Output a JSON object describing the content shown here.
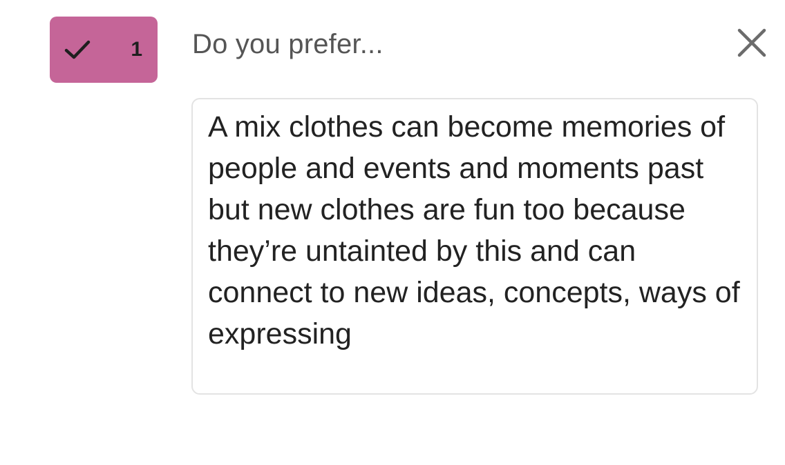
{
  "vote": {
    "icon": "check-icon",
    "count": "1",
    "color": "#c56598"
  },
  "question": {
    "label": "Do you prefer..."
  },
  "close": {
    "icon": "close-icon"
  },
  "answer": {
    "text": "A mix clothes can become memories of people and events and moments past but new clothes are fun too because they’re untainted by this and can connect to new ideas, concepts, ways of expressing"
  }
}
